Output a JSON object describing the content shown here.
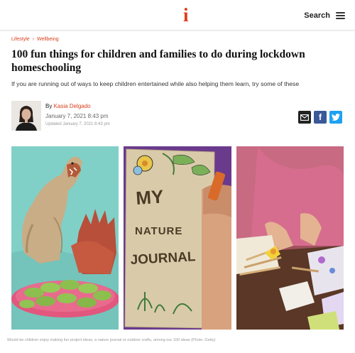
{
  "header": {
    "logo": "i",
    "search_label": "Search"
  },
  "breadcrumb": {
    "items": [
      "Lifestyle",
      "Wellbeing"
    ]
  },
  "article": {
    "title": "100 fun things for children and families to do during lockdown homeschooling",
    "standfirst": "If you are running out of ways to keep children entertained while also helping them learn, try some of these",
    "byline_prefix": "By",
    "author": "Kasia Delgado",
    "date": "January 7, 2021 8:43 pm",
    "updated": "Updated January 7, 2021 8:43 pm"
  },
  "share": {
    "icons": [
      "email-icon",
      "facebook-icon",
      "twitter-icon"
    ]
  },
  "images": {
    "journal_text": [
      "MY",
      "NATURE",
      "JOURNAL"
    ]
  },
  "caption": "Would-be children enjoy making fun project ideas, a nature journal or outdoor crafts, among our 100 ideas (Photo: Getty)",
  "colors": {
    "accent": "#d9401e",
    "logo": "#e03c19",
    "facebook": "#3b5998",
    "twitter": "#1da1f2"
  }
}
